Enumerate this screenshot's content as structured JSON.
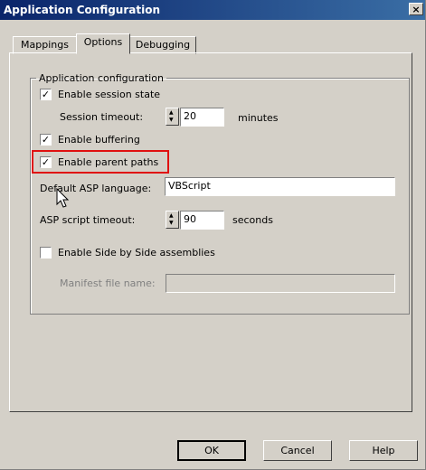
{
  "window": {
    "title": "Application Configuration",
    "close_glyph": "×"
  },
  "tabs": [
    {
      "label": "Mappings"
    },
    {
      "label": "Options"
    },
    {
      "label": "Debugging"
    }
  ],
  "group": {
    "legend": "Application configuration"
  },
  "options": {
    "session_state": {
      "label": "Enable session state",
      "checked": true
    },
    "session_timeout": {
      "label": "Session timeout:",
      "value": "20",
      "unit": "minutes"
    },
    "buffering": {
      "label": "Enable buffering",
      "checked": true
    },
    "parent_paths": {
      "label": "Enable parent paths",
      "checked": true
    },
    "default_language": {
      "label": "Default ASP language:",
      "value": "VBScript"
    },
    "script_timeout": {
      "label": "ASP script timeout:",
      "value": "90",
      "unit": "seconds"
    },
    "side_by_side": {
      "label": "Enable Side by Side assemblies",
      "checked": false
    },
    "manifest": {
      "label": "Manifest file name:",
      "value": ""
    }
  },
  "check_glyph": "✓",
  "buttons": {
    "ok": "OK",
    "cancel": "Cancel",
    "help": "Help"
  },
  "colors": {
    "highlight": "#e01010",
    "titlebar_start": "#0a246a",
    "titlebar_end": "#3a6ea5"
  }
}
